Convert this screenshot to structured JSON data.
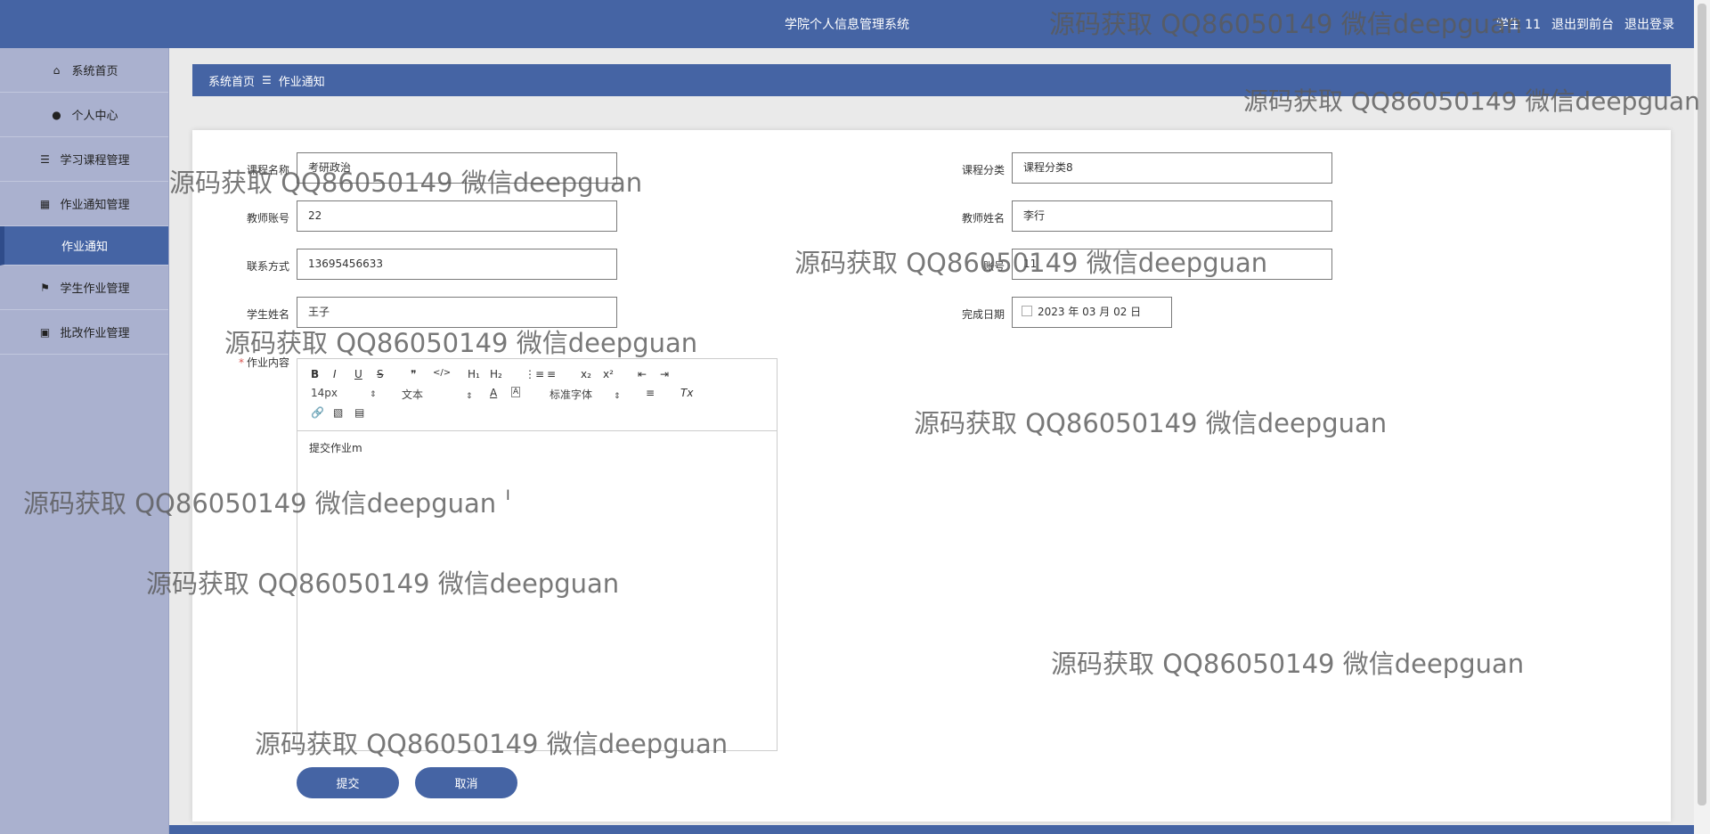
{
  "header": {
    "title": "学院个人信息管理系统",
    "user": "学生 11",
    "back_front": "退出到前台",
    "logout": "退出登录"
  },
  "sidebar": {
    "items": [
      {
        "label": "系统首页",
        "icon": "home-icon"
      },
      {
        "label": "个人中心",
        "icon": "user-icon"
      },
      {
        "label": "学习课程管理",
        "icon": "sliders-icon"
      },
      {
        "label": "作业通知管理",
        "icon": "grid-icon"
      },
      {
        "label": "作业通知",
        "icon": ""
      },
      {
        "label": "学生作业管理",
        "icon": "flag-icon"
      },
      {
        "label": "批改作业管理",
        "icon": "clipboard-icon"
      }
    ]
  },
  "breadcrumb": {
    "home": "系统首页",
    "sep": "☰",
    "current": "作业通知"
  },
  "form": {
    "course_name": {
      "label": "课程名称",
      "value": "考研政治"
    },
    "course_category": {
      "label": "课程分类",
      "value": "课程分类8"
    },
    "teacher_account": {
      "label": "教师账号",
      "value": "22"
    },
    "teacher_name": {
      "label": "教师姓名",
      "value": "李行"
    },
    "contact": {
      "label": "联系方式",
      "value": "13695456633"
    },
    "account": {
      "label": "账号",
      "value": "11"
    },
    "student_name": {
      "label": "学生姓名",
      "value": "王子"
    },
    "finish_date": {
      "label": "完成日期",
      "value": "2023 年 03 月 02 日"
    },
    "homework_content": {
      "label": "作业内容",
      "required_mark": "*",
      "value": "提交作业m"
    }
  },
  "editor": {
    "bold": "B",
    "italic": "I",
    "underline": "U",
    "strike": "S",
    "quote": "❞",
    "code": "</>",
    "h1": "H₁",
    "h2": "H₂",
    "ordered": "⋮≡",
    "bullet": "≡",
    "sub": "x₂",
    "sup": "x²",
    "outdent": "⇤",
    "indent": "⇥",
    "size": "14px",
    "block": "文本",
    "font": "标准字体",
    "clean": "Tx"
  },
  "buttons": {
    "submit": "提交",
    "cancel": "取消"
  },
  "cursor_glyph": "I",
  "watermark": "源码获取 QQ86050149 微信deepguan",
  "colors": {
    "primary": "#4564a4",
    "sidebar": "#aab1cf"
  }
}
